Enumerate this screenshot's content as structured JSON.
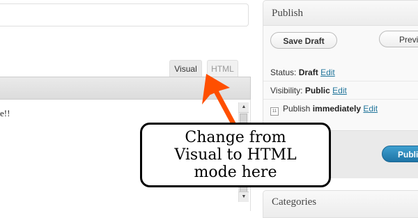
{
  "editor": {
    "tabs": [
      {
        "label": "Visual"
      },
      {
        "label": "HTML"
      }
    ],
    "content_text": "e!!"
  },
  "publish": {
    "title": "Publish",
    "save_draft_label": "Save Draft",
    "preview_label": "Previ",
    "status_label": "Status:",
    "status_value": "Draft",
    "status_edit": "Edit",
    "visibility_label": "Visibility:",
    "visibility_value": "Public",
    "visibility_edit": "Edit",
    "schedule_label": "Publish",
    "schedule_value": "immediately",
    "schedule_edit": "Edit",
    "publish_button": "Publi",
    "colors": {
      "publish_button": "#2a87bc",
      "link": "#21759b"
    }
  },
  "categories": {
    "title": "Categories"
  },
  "annotation": {
    "text": "Change from\nVisual to HTML\nmode here",
    "arrow_color": "#ff4f00"
  },
  "icons": {
    "calendar": "calendar-icon",
    "scroll_up": "scroll-up-arrow-icon",
    "scroll_down": "scroll-down-arrow-icon",
    "arrow": "annotation-arrow-icon"
  }
}
